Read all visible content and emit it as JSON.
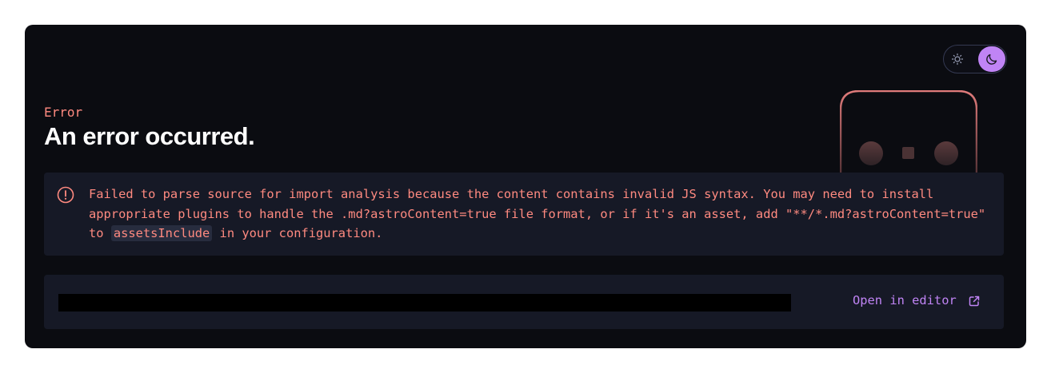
{
  "error": {
    "label": "Error",
    "title": "An error occurred.",
    "message_before": "Failed to parse source for import analysis because the content contains invalid JS syntax. You may need to install appropriate plugins to handle the .md?astroContent=true file format, or if it's an asset, add \"**/*.md?astroContent=true\" to ",
    "message_code": "assetsInclude",
    "message_after": " in your configuration."
  },
  "editor": {
    "open_label": "Open in editor"
  },
  "theme": {
    "mode": "dark",
    "icons": [
      "sun-icon",
      "moon-icon"
    ]
  },
  "colors": {
    "background": "#0b0c11",
    "panel": "#161926",
    "error_text": "#ff8a80",
    "accent": "#c084f5",
    "title": "#ffffff"
  }
}
